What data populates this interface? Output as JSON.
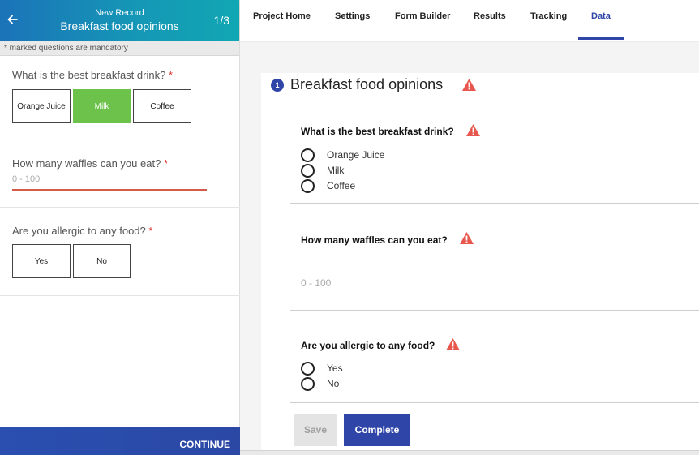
{
  "colors": {
    "header_gradient_start": "#1b73b8",
    "header_gradient_end": "#11a7b3",
    "selected_choice": "#6cc24a",
    "required_asterisk": "#d9342b",
    "input_error_line": "#d35b48",
    "primary_blue": "#2f45a8",
    "warning_red": "#e8574d"
  },
  "mobile": {
    "header": {
      "back_icon": "arrow-left-icon",
      "subtitle": "New Record",
      "title": "Breakfast food opinions",
      "page_counter": "1/3"
    },
    "mandatory_note": "* marked questions are mandatory",
    "questions": [
      {
        "label": "What is the best breakfast drink?",
        "required_mark": "*",
        "choices": [
          "Orange Juice",
          "Milk",
          "Coffee"
        ],
        "selected": "Milk"
      },
      {
        "label": "How many waffles can you eat?",
        "required_mark": "*",
        "placeholder": "0 - 100"
      },
      {
        "label": "Are you allergic to any food?",
        "required_mark": "*",
        "choices": [
          "Yes",
          "No"
        ]
      }
    ],
    "continue_label": "CONTINUE"
  },
  "nav": {
    "items": [
      "Project Home",
      "Settings",
      "Form Builder",
      "Results",
      "Tracking",
      "Data"
    ],
    "active": "Data"
  },
  "form": {
    "step_number": "1",
    "title": "Breakfast food opinions",
    "warning_icon": "warning-triangle-icon",
    "questions": [
      {
        "label": "What is the best breakfast drink?",
        "options": [
          "Orange Juice",
          "Milk",
          "Coffee"
        ]
      },
      {
        "label": "How many waffles can you eat?",
        "placeholder": "0 - 100"
      },
      {
        "label": "Are you allergic to any food?",
        "options": [
          "Yes",
          "No"
        ]
      }
    ],
    "save_label": "Save",
    "complete_label": "Complete"
  }
}
